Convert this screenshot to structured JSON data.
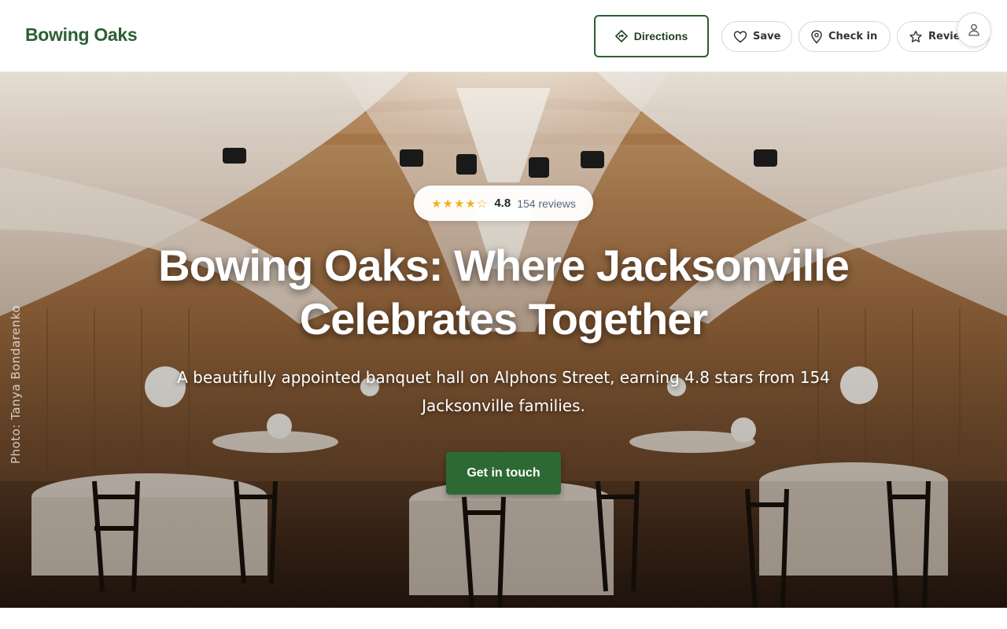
{
  "header": {
    "brand": "Bowing Oaks",
    "directions_label": "Directions",
    "save_label": "Save",
    "checkin_label": "Check in",
    "review_label": "Review"
  },
  "hero": {
    "rating_stars": "★★★★☆",
    "rating_value": "4.8",
    "rating_count": "154 reviews",
    "title_line1": "Bowing Oaks: Where Jacksonville",
    "title_line2": "Celebrates Together",
    "subtitle": "A beautifully appointed banquet hall on Alphons Street, earning 4.8 stars from 154 Jacksonville families.",
    "cta_label": "Get in touch",
    "photo_credit": "Photo: Tanya Bondarenko"
  },
  "rating": {
    "value": 4.8,
    "max": 5
  },
  "colors": {
    "brand": "#2d5e32",
    "cta": "#2d6a33",
    "star": "#f2b01e"
  },
  "icons": {
    "directions": "directions-diamond-icon",
    "save": "heart-icon",
    "checkin": "map-pin-icon",
    "review": "star-icon",
    "account": "user-icon"
  }
}
